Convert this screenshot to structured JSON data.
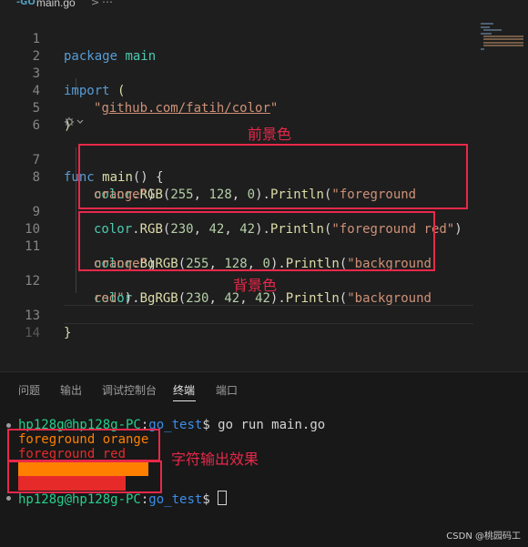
{
  "tab": {
    "filename": "main.go",
    "badge": "-GO",
    "crumb_sep": ">",
    "crumb_more": "⋯"
  },
  "editor": {
    "line_numbers": [
      "1",
      "2",
      "3",
      "4",
      "5",
      "6",
      "7",
      "8",
      "9",
      "10",
      "11",
      "12",
      "13",
      "14"
    ],
    "codelens_icon": "run-test-icon",
    "line1": {
      "kw": "package",
      "name": "main"
    },
    "line3": {
      "kw": "import",
      "paren": "("
    },
    "line4": {
      "q1": "\"",
      "url": "github.com/fatih/color",
      "q2": "\""
    },
    "line5": {
      "paren": ")"
    },
    "line7": {
      "kw": "func",
      "name": "main",
      "rest": "() {"
    },
    "line8": {
      "pkg": "color",
      "dot": ".",
      "fn1": "RGB",
      "open": "(",
      "a": "255",
      "c1": ", ",
      "b": "128",
      "c2": ", ",
      "c": "0",
      "close": ").",
      "fn2": "Println",
      "p": "(",
      "str": "\"foreground"
    },
    "line8b": {
      "str": "orange\"",
      "close": ")"
    },
    "line9": {
      "pkg": "color",
      "dot": ".",
      "fn1": "RGB",
      "open": "(",
      "a": "230",
      "c1": ", ",
      "b": "42",
      "c2": ", ",
      "c": "42",
      "close": ").",
      "fn2": "Println",
      "p": "(",
      "str": "\"foreground red\"",
      "end": ")"
    },
    "line11": {
      "pkg": "color",
      "dot": ".",
      "fn1": "BgRGB",
      "open": "(",
      "a": "255",
      "c1": ", ",
      "b": "128",
      "c2": ", ",
      "c": "0",
      "close": ").",
      "fn2": "Println",
      "p": "(",
      "str": "\"background"
    },
    "line11b": {
      "str": "orange\"",
      "close": ")"
    },
    "line12": {
      "pkg": "color",
      "dot": ".",
      "fn1": "BgRGB",
      "open": "(",
      "a": "230",
      "c1": ", ",
      "b": "42",
      "c2": ", ",
      "c": "42",
      "close": ").",
      "fn2": "Println",
      "p": "(",
      "str": "\"background"
    },
    "line12b": {
      "str": "red\"",
      "close": ")"
    },
    "line13": {
      "brace": "}"
    }
  },
  "annotations": {
    "foreground": "前景色",
    "background": "背景色",
    "output": "字符输出效果",
    "color": "#e8284a"
  },
  "panel": {
    "tabs": [
      "问题",
      "输出",
      "调试控制台",
      "终端",
      "端口"
    ],
    "active_tab": "终端"
  },
  "terminal": {
    "prompt1": {
      "user": "hp128g@hp128g-PC",
      "colon": ":",
      "dir": "go_test",
      "dollar": "$ ",
      "cmd": "go run main.go"
    },
    "out1": "foreground orange",
    "out2": "foreground red",
    "out3": "background orange",
    "out4": "background red",
    "prompt2": {
      "user": "hp128g@hp128g-PC",
      "colon": ":",
      "dir": "go_test",
      "dollar": "$ "
    }
  },
  "colors": {
    "orange": "#ff8000",
    "red": "#e62a2a",
    "prompt_green": "#23d18b",
    "prompt_blue": "#3b8eea"
  },
  "watermark": "CSDN @桃园码工"
}
